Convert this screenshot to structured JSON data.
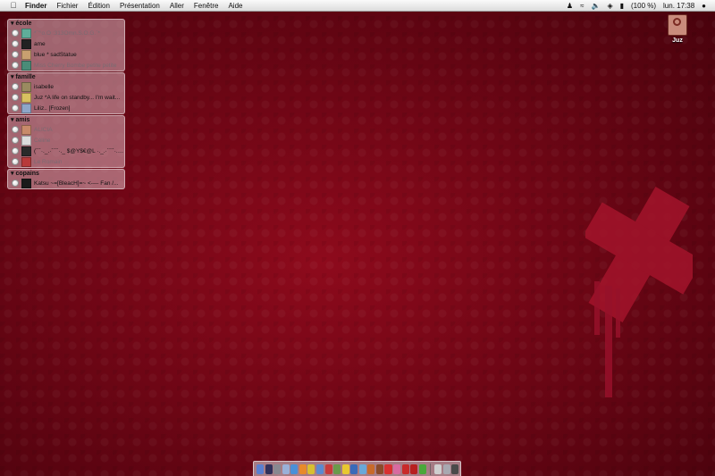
{
  "menubar": {
    "apple_icon": "apple-icon",
    "app_name": "Finder",
    "menus": [
      "Fichier",
      "Édition",
      "Présentation",
      "Aller",
      "Fenêtre",
      "Aide"
    ],
    "battery": "(100 %)",
    "clock": "lun. 17:38"
  },
  "buddy_groups": [
    {
      "name": "école",
      "buddies": [
        {
          "name": "*`'°o.O :313Omn.S.O.G.`*",
          "status": "idle",
          "avatar_color": "#5fae9a"
        },
        {
          "name": "ame",
          "status": "available",
          "avatar_color": "#222222"
        },
        {
          "name": "blue * sadStatue",
          "status": "available",
          "avatar_color": "#c8a070"
        },
        {
          "name": "Miss Cherry Bombe petite petite",
          "status": "idle",
          "avatar_color": "#4a8c78"
        }
      ]
    },
    {
      "name": "famille",
      "buddies": [
        {
          "name": "isabelle",
          "status": "available",
          "avatar_color": "#9a8a60"
        },
        {
          "name": "Juz *A life on standby... I'm wait...",
          "status": "available",
          "avatar_color": "#d8c060"
        },
        {
          "name": "Liliz.. [Frozen]",
          "status": "available",
          "avatar_color": "#8ea6c8"
        }
      ]
    },
    {
      "name": "amis",
      "buddies": [
        {
          "name": "ALICIA",
          "status": "idle",
          "avatar_color": "#c88a6a"
        },
        {
          "name": "Céline",
          "status": "idle",
          "avatar_color": "#dcdcdc"
        },
        {
          "name": "(¯`·._.·´¯`·._ $@Y$€@L ·._.·´¯`·._.·",
          "status": "available",
          "avatar_color": "#2a2a2a"
        },
        {
          "name": "Le Romain",
          "status": "idle",
          "avatar_color": "#b83a3a"
        }
      ]
    },
    {
      "name": "copains",
      "buddies": [
        {
          "name": "Katsu ~=[BleacH]=~ <---- Fan /...",
          "status": "available",
          "avatar_color": "#1a1a1a"
        }
      ]
    }
  ],
  "desktop_icon": {
    "label": "Juz",
    "icon": "hard-drive-icon"
  },
  "dock_apps": [
    {
      "icon": "finder-icon",
      "color": "#5a7fd0"
    },
    {
      "icon": "dashboard-icon",
      "color": "#30305a"
    },
    {
      "icon": "system-prefs-icon",
      "color": "#888890"
    },
    {
      "icon": "mail-icon",
      "color": "#9ab0d8"
    },
    {
      "icon": "safari-icon",
      "color": "#4a90d8"
    },
    {
      "icon": "firefox-icon",
      "color": "#e88a2a"
    },
    {
      "icon": "adium-icon",
      "color": "#d8c030"
    },
    {
      "icon": "itunes-icon",
      "color": "#5a8ad0"
    },
    {
      "icon": "ical-icon",
      "color": "#c83a3a"
    },
    {
      "icon": "preview-icon",
      "color": "#6a9a4a"
    },
    {
      "icon": "radioactive-icon",
      "color": "#e8c830"
    },
    {
      "icon": "photoshop-icon",
      "color": "#3a6ab8"
    },
    {
      "icon": "bird-icon",
      "color": "#6aa8d8"
    },
    {
      "icon": "illustrator-icon",
      "color": "#c86a2a"
    },
    {
      "icon": "app-icon",
      "color": "#8a4a2a"
    },
    {
      "icon": "red-app-icon",
      "color": "#d83030"
    },
    {
      "icon": "pink-app-icon",
      "color": "#d86aa0"
    },
    {
      "icon": "tomato-app-icon",
      "color": "#c82a2a"
    },
    {
      "icon": "apple-red-icon",
      "color": "#b82020"
    },
    {
      "icon": "leaf-icon",
      "color": "#4aa83a"
    }
  ],
  "dock_minimized": [
    {
      "icon": "window-thumb-icon",
      "color": "#cfcfcf"
    },
    {
      "icon": "window-thumb-icon",
      "color": "#a8a8b0"
    },
    {
      "icon": "trash-icon",
      "color": "#4a4a4a"
    }
  ]
}
